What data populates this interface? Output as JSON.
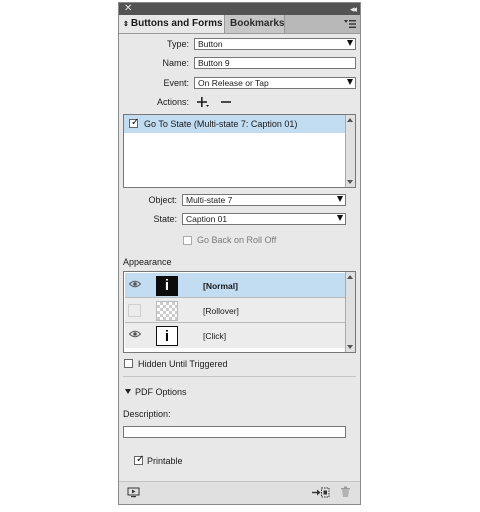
{
  "panel": {
    "tabs": [
      {
        "label": "Buttons and Forms",
        "active": true
      },
      {
        "label": "Bookmarks",
        "active": false
      }
    ]
  },
  "form": {
    "type_label": "Type:",
    "type_value": "Button",
    "name_label": "Name:",
    "name_value": "Button 9",
    "event_label": "Event:",
    "event_value": "On Release or Tap",
    "actions_label": "Actions:",
    "actions": [
      {
        "label": "Go To State (Multi-state 7: Caption 01)",
        "checked": true
      }
    ],
    "object_label": "Object:",
    "object_value": "Multi-state 7",
    "state_label": "State:",
    "state_value": "Caption 01",
    "goback_label": "Go Back on Roll Off"
  },
  "appearance": {
    "heading": "Appearance",
    "states": [
      {
        "name": "[Normal]",
        "visible": true,
        "selected": true,
        "thumb": "i-black"
      },
      {
        "name": "[Rollover]",
        "visible": false,
        "selected": false,
        "thumb": "empty"
      },
      {
        "name": "[Click]",
        "visible": true,
        "selected": false,
        "thumb": "i-white"
      }
    ],
    "thumb_glyph": "i"
  },
  "hidden_label": "Hidden Until Triggered",
  "pdf": {
    "heading": "PDF Options",
    "description_label": "Description:",
    "description_value": "",
    "printable_label": "Printable",
    "printable_checked": true
  },
  "colors": {
    "panel_bg": "#e8e8e8",
    "selected_row": "#c2dcf2",
    "titlebar": "#535353"
  }
}
